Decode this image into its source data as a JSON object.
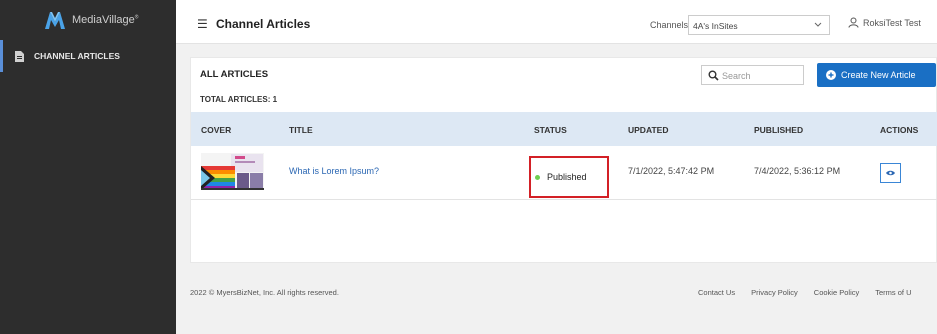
{
  "app": {
    "logo_text": "MediaVillage",
    "logo_mark": "®"
  },
  "sidebar": {
    "items": [
      {
        "label": "CHANNEL ARTICLES",
        "icon": "document-icon"
      }
    ]
  },
  "header": {
    "title": "Channel Articles",
    "channels_label": "Channels",
    "channels_selected": "4A's InSites",
    "user_name": "RoksiTest Test"
  },
  "toolbar": {
    "section_title": "ALL ARTICLES",
    "total_label": "TOTAL ARTICLES: 1",
    "search_placeholder": "Search",
    "create_label": "Create New Article"
  },
  "table": {
    "columns": [
      "COVER",
      "TITLE",
      "STATUS",
      "UPDATED",
      "PUBLISHED",
      "ACTIONS"
    ],
    "rows": [
      {
        "title": "What is Lorem Ipsum?",
        "status": "Published",
        "updated": "7/1/2022, 5:47:42 PM",
        "published": "7/4/2022, 5:36:12 PM"
      }
    ]
  },
  "footer": {
    "copyright": "2022 © MyersBizNet, Inc. All rights reserved.",
    "links": [
      "Contact Us",
      "Privacy Policy",
      "Cookie Policy",
      "Terms of U"
    ]
  },
  "colors": {
    "sidebar_bg": "#2d2d2d",
    "accent": "#1a6fc4",
    "status_published": "#6fcf51",
    "highlight_box": "#d32026",
    "table_header_bg": "#dde8f4"
  }
}
